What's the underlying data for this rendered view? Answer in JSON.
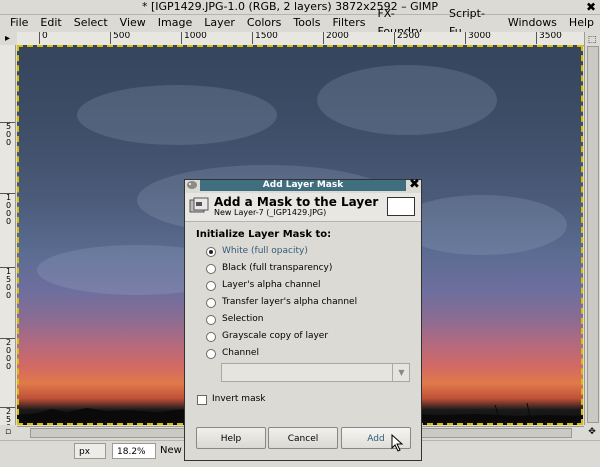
{
  "window": {
    "title": "* [IGP1429.JPG-1.0 (RGB, 2 layers) 3872x2592 – GIMP",
    "close_glyph": "✖"
  },
  "menu": [
    "File",
    "Edit",
    "Select",
    "View",
    "Image",
    "Layer",
    "Colors",
    "Tools",
    "Filters",
    "FX-Foundry",
    "Script-Fu",
    "Windows",
    "Help"
  ],
  "ruler": {
    "h_ticks": [
      "0",
      "500",
      "1000",
      "1500",
      "2000",
      "2500",
      "3000",
      "3500"
    ],
    "v_ticks": [
      "5\n0\n0",
      "1\n0\n0\n0",
      "1\n5\n0\n0",
      "2\n0\n0\n0",
      "2\n5\n0\n0"
    ]
  },
  "status": {
    "unit": "px",
    "zoom": "18.2%",
    "message": "New"
  },
  "dialog": {
    "title": "Add Layer Mask",
    "header_title": "Add a Mask to the Layer",
    "header_subtitle": "New Layer-7 (_IGP1429.JPG)",
    "section_title": "Initialize Layer Mask to:",
    "options": [
      {
        "label": "White (full opacity)",
        "selected": true
      },
      {
        "label": "Black (full transparency)",
        "selected": false
      },
      {
        "label": "Layer's alpha channel",
        "selected": false
      },
      {
        "label": "Transfer layer's alpha channel",
        "selected": false
      },
      {
        "label": "Selection",
        "selected": false
      },
      {
        "label": "Grayscale copy of layer",
        "selected": false
      },
      {
        "label": "Channel",
        "selected": false
      }
    ],
    "invert_label": "Invert mask",
    "invert_checked": false,
    "buttons": {
      "help": "Help",
      "cancel": "Cancel",
      "add": "Add"
    },
    "close_glyph": "✖"
  }
}
